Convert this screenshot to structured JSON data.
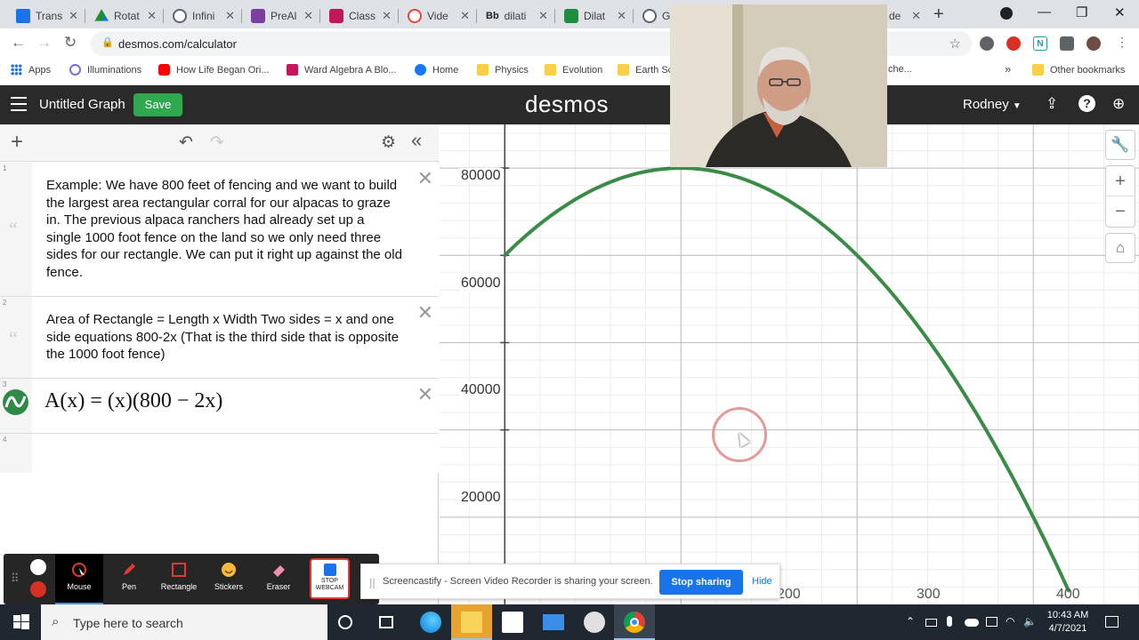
{
  "browser": {
    "tabs": [
      {
        "label": "Trans",
        "color": "#1a73e8",
        "icon": "doc-icon"
      },
      {
        "label": "Rotat",
        "color": "#fbbc04",
        "icon": "drive-icon"
      },
      {
        "label": "Infini",
        "color": "#5f6368",
        "icon": "globe-icon"
      },
      {
        "label": "PreAl",
        "color": "#7b3fa0",
        "icon": "forms-icon"
      },
      {
        "label": "Class",
        "color": "#c2185b",
        "icon": "classroom-icon"
      },
      {
        "label": "Vide",
        "color": "#e8453c",
        "icon": "video-icon"
      },
      {
        "label": "dilati",
        "color": "#222222",
        "icon": "blackboard-icon",
        "prefix": "Bb"
      },
      {
        "label": "Dilat",
        "color": "#1e8e3e",
        "icon": "sheet-icon"
      },
      {
        "label": "Geor",
        "color": "#5f6368",
        "icon": "geogebra-icon"
      }
    ],
    "partial_tab_fragment": "de",
    "url": "desmos.com/calculator",
    "bookmarks": [
      {
        "label": "Apps",
        "icon": "apps-icon"
      },
      {
        "label": "Illuminations",
        "icon": "illuminations-icon"
      },
      {
        "label": "How Life Began Ori...",
        "icon": "youtube-icon"
      },
      {
        "label": "Ward Algebra A Blo...",
        "icon": "classroom-icon"
      },
      {
        "label": "Home",
        "icon": "facebook-icon"
      },
      {
        "label": "Physics",
        "icon": "folder-icon"
      },
      {
        "label": "Evolution",
        "icon": "folder-icon"
      },
      {
        "label": "Earth Sc",
        "icon": "folder-icon"
      }
    ],
    "bookmark_fragment": "che...",
    "other_bookmarks": "Other bookmarks",
    "more_bookmarks": "»"
  },
  "desmos": {
    "graph_title": "Untitled Graph",
    "save_label": "Save",
    "logo": "desmos",
    "user": "Rodney",
    "expressions": [
      {
        "index": "1",
        "type": "note",
        "text": "Example:  We have 800 feet of fencing and we want to build the largest area rectangular corral for our alpacas to graze in.  The previous alpaca ranchers had already set up a single 1000 foot fence on the land so we only need three sides for our rectangle.  We can put it right up against the old fence."
      },
      {
        "index": "2",
        "type": "note",
        "text": "Area of Rectangle = Length x Width  Two sides = x and one side equations 800-2x (That is the third side that is opposite the 1000 foot fence)"
      },
      {
        "index": "3",
        "type": "function",
        "color": "#388c46",
        "latex": "A(x) = (x)(800 − 2x)"
      },
      {
        "index": "4",
        "type": "empty"
      }
    ]
  },
  "graph": {
    "y_ticks": [
      "80000",
      "60000",
      "40000",
      "20000"
    ],
    "x_ticks": [
      "200",
      "300",
      "400"
    ],
    "curve_color": "#388c46"
  },
  "chart_data": {
    "type": "line",
    "title": "",
    "xlabel": "",
    "ylabel": "",
    "series": [
      {
        "name": "",
        "x": [
          120,
          150,
          200,
          250,
          300,
          350,
          400
        ],
        "values": [
          67200,
          75000,
          80000,
          75000,
          60000,
          35000,
          0
        ]
      }
    ],
    "xlim": [
      63,
      460
    ],
    "ylim": [
      -20000,
      90000
    ],
    "grid": true
  },
  "screencastify": {
    "tools": [
      "Mouse",
      "Pen",
      "Rectangle",
      "Stickers",
      "Eraser"
    ],
    "webcam_label": "STOP WEBCAM",
    "share_message": "Screencastify - Screen Video Recorder is sharing your screen.",
    "stop_sharing": "Stop sharing",
    "hide": "Hide"
  },
  "taskbar": {
    "search_placeholder": "Type here to search",
    "time": "10:43 AM",
    "date": "4/7/2021"
  }
}
